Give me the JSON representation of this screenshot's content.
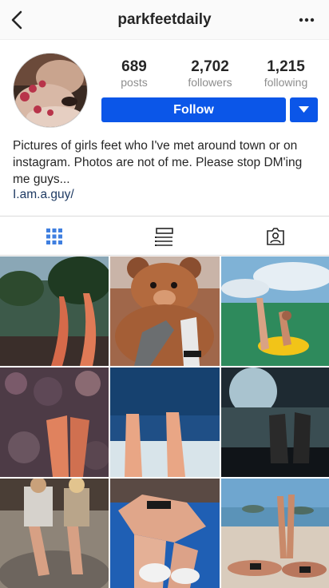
{
  "header": {
    "username": "parkfeetdaily",
    "back_icon": "chevron-left-icon",
    "more_icon": "more-horizontal-icon"
  },
  "profile": {
    "stats": [
      {
        "id": "posts",
        "value": "689",
        "label": "posts"
      },
      {
        "id": "followers",
        "value": "2,702",
        "label": "followers"
      },
      {
        "id": "following",
        "value": "1,215",
        "label": "following"
      }
    ],
    "follow_label": "Follow",
    "bio": "Pictures of girls feet who I've met around town or on instagram. Photos are not of me. Please stop DM'ing me guys...",
    "link": "I.am.a.guy/",
    "accent_color": "#0b56e8"
  },
  "tabs": [
    {
      "id": "grid",
      "icon": "grid-icon",
      "active": true
    },
    {
      "id": "list",
      "icon": "list-icon",
      "active": false
    },
    {
      "id": "tagged",
      "icon": "tagged-person-icon",
      "active": false
    }
  ],
  "posts": [
    {
      "id": "post-1",
      "subject": "legs-palm-trees"
    },
    {
      "id": "post-2",
      "subject": "teddy-bear-socks"
    },
    {
      "id": "post-3",
      "subject": "feet-ocean-float"
    },
    {
      "id": "post-4",
      "subject": "feet-flowers"
    },
    {
      "id": "post-5",
      "subject": "feet-beach-sky"
    },
    {
      "id": "post-6",
      "subject": "feet-car-window"
    },
    {
      "id": "post-7",
      "subject": "girls-on-rock"
    },
    {
      "id": "post-8",
      "subject": "sunbathing-chair"
    },
    {
      "id": "post-9",
      "subject": "beach-legs-up"
    }
  ]
}
